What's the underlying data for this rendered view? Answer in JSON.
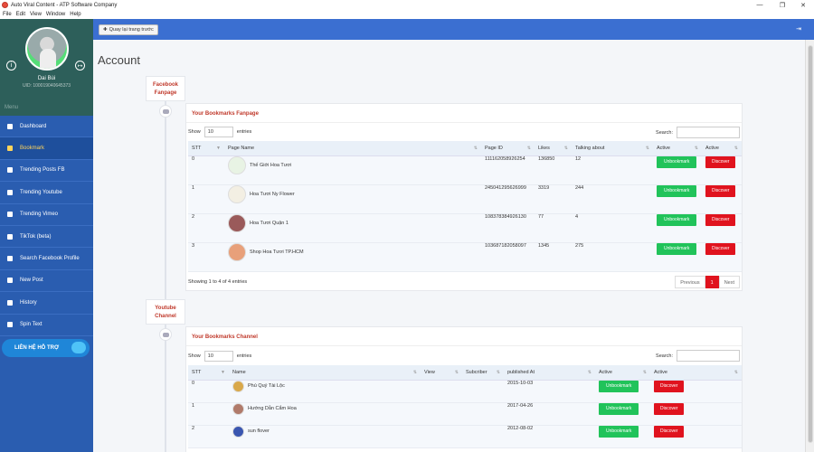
{
  "window": {
    "title": "Auto Viral Content - ATP Software Company",
    "controls": [
      "—",
      "❐",
      "✕"
    ]
  },
  "menubar": [
    "File",
    "Edit",
    "View",
    "Window",
    "Help"
  ],
  "profile": {
    "name": "Dai Bùi",
    "uid": "UID: 100019040645373"
  },
  "sidebar": {
    "menu_label": "Menu",
    "items": [
      {
        "label": "Dashboard",
        "icon": "monitor-icon"
      },
      {
        "label": "Bookmark",
        "icon": "bookmark-icon",
        "active": true
      },
      {
        "label": "Trending Posts FB",
        "icon": "facebook-icon"
      },
      {
        "label": "Trending Youtube",
        "icon": "youtube-icon"
      },
      {
        "label": "Trending Vimeo",
        "icon": "vimeo-icon"
      },
      {
        "label": "TikTok (beta)",
        "icon": "tiktok-icon"
      },
      {
        "label": "Search Facebook Profile",
        "icon": "search-icon"
      },
      {
        "label": "New Post",
        "icon": "post-icon"
      },
      {
        "label": "History",
        "icon": "history-icon"
      },
      {
        "label": "Spin Text",
        "icon": "spin-icon"
      }
    ],
    "contact": "LIÊN HỆ HỖ TRỢ"
  },
  "topbar": {
    "back_label": "Quay lại trang trước",
    "expand_icon": "⇥"
  },
  "page": {
    "title": "Account"
  },
  "fanpage_section": {
    "tag_line1": "Facebook",
    "tag_line2": "Fanpage",
    "panel_title": "Your Bookmarks Fanpage",
    "show_label": "Show",
    "show_value": "10",
    "entries_label": "entries",
    "search_label": "Search:",
    "columns": [
      "STT",
      "Page Name",
      "Page ID",
      "Likes",
      "Talking about",
      "Active",
      "Active"
    ],
    "rows": [
      {
        "stt": "0",
        "name": "Thế Giới Hoa Tươi",
        "page_id": "111162058926254",
        "likes": "136850",
        "talking": "12",
        "thumb_color": "#e8f3e4"
      },
      {
        "stt": "1",
        "name": "Hoa Tươi Ny Flower",
        "page_id": "245041295626999",
        "likes": "3319",
        "talking": "244",
        "thumb_color": "#f3efe3"
      },
      {
        "stt": "2",
        "name": "Hoa Tươi Quận 1",
        "page_id": "108378384926130",
        "likes": "77",
        "talking": "4",
        "thumb_color": "#9a5a5a"
      },
      {
        "stt": "3",
        "name": "Shop Hoa Tươi TP.HCM",
        "page_id": "103687182058097",
        "likes": "1345",
        "talking": "275",
        "thumb_color": "#e8a07a"
      }
    ],
    "unbookmark_label": "Unbookmark",
    "discover_label": "Discover",
    "info": "Showing 1 to 4 of 4 entries",
    "pager": {
      "prev": "Previous",
      "current": "1",
      "next": "Next"
    }
  },
  "channel_section": {
    "tag_line1": "Youtube",
    "tag_line2": "Channel",
    "panel_title": "Your Bookmarks Channel",
    "show_label": "Show",
    "show_value": "10",
    "entries_label": "entries",
    "search_label": "Search:",
    "columns": [
      "STT",
      "Name",
      "View",
      "Subcriber",
      "published At",
      "Active",
      "Active"
    ],
    "rows": [
      {
        "stt": "0",
        "name": "Phú Quý Tài Lộc",
        "published": "2015-10-03",
        "thumb_color": "#d9a84a"
      },
      {
        "stt": "1",
        "name": "Hướng Dẫn Cắm Hoa",
        "published": "2017-04-26",
        "thumb_color": "#b07a6a"
      },
      {
        "stt": "2",
        "name": "sun flover",
        "published": "2012-08-02",
        "thumb_color": "#3a56b0"
      }
    ],
    "unbookmark_label": "Unbookmark",
    "discover_label": "Discover"
  }
}
